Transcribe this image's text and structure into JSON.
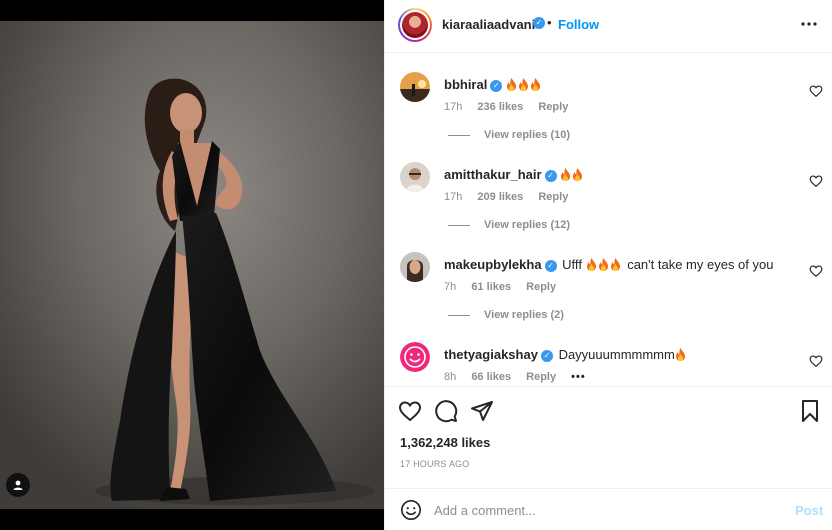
{
  "post": {
    "owner": "kiaraaliaadvani",
    "separator": "•",
    "follow_label": "Follow",
    "verified_mark": "✓"
  },
  "comments": [
    {
      "username": "bbhiral",
      "verified": true,
      "text": "",
      "emoji": [
        "fire",
        "fire",
        "fire"
      ],
      "time": "17h",
      "likes": "236 likes",
      "reply_label": "Reply",
      "view_replies": "View replies (10)"
    },
    {
      "username": "amitthakur_hair",
      "verified": true,
      "text": "",
      "emoji": [
        "fire",
        "fire"
      ],
      "time": "17h",
      "likes": "209 likes",
      "reply_label": "Reply",
      "view_replies": "View replies (12)"
    },
    {
      "username": "makeupbylekha",
      "verified": true,
      "text_before": "Ufff",
      "emoji": [
        "fire",
        "fire",
        "fire"
      ],
      "text_after": "can't take my eyes of you",
      "time": "7h",
      "likes": "61 likes",
      "reply_label": "Reply",
      "view_replies": "View replies (2)"
    },
    {
      "username": "thetyagiakshay",
      "verified": true,
      "text": "Dayyuuummmmmm",
      "emoji": [
        "fire"
      ],
      "time": "8h",
      "likes": "66 likes",
      "reply_label": "Reply",
      "more": "•••"
    }
  ],
  "actions": {
    "likes_count": "1,362,248 likes",
    "timestamp": "17 HOURS AGO"
  },
  "add_comment": {
    "placeholder": "Add a comment...",
    "post_label": "Post"
  },
  "colors": {
    "accent": "#0095f6",
    "verified": "#3897f0",
    "muted": "#8e8e8e",
    "post_disabled": "#b2dffc"
  },
  "icons": {
    "like": "heart-icon",
    "comment": "comment-bubble-icon",
    "share": "paper-plane-icon",
    "save": "bookmark-icon",
    "more": "more-horizontal-icon",
    "emoji": "smiley-icon",
    "tag": "user-tag-icon"
  }
}
